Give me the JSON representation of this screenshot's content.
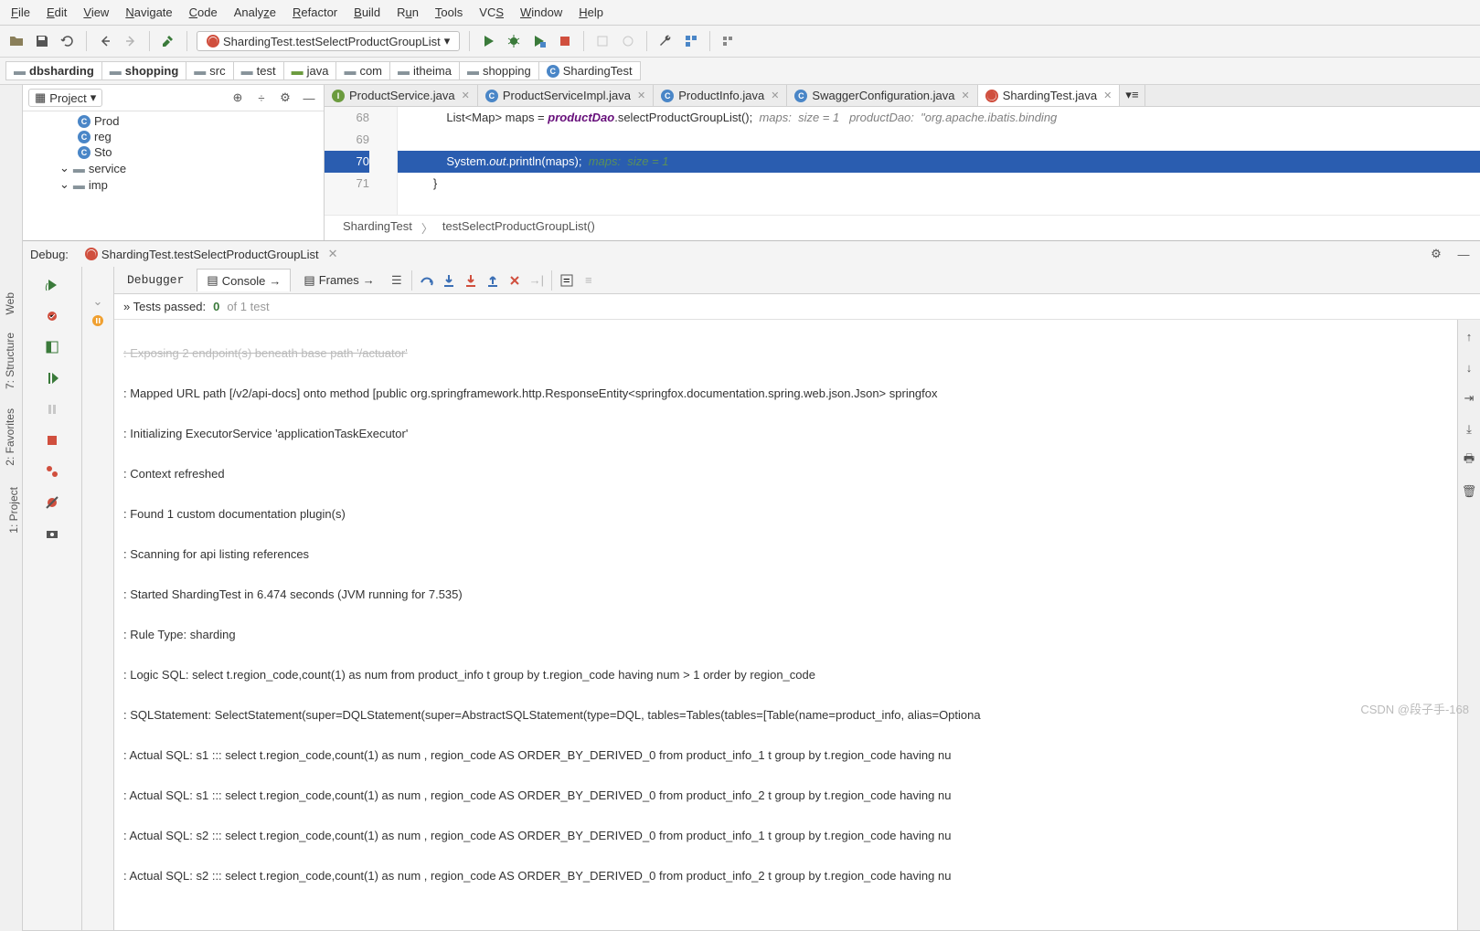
{
  "menu": {
    "file": "File",
    "edit": "Edit",
    "view": "View",
    "navigate": "Navigate",
    "code": "Code",
    "analyze": "Analyze",
    "refactor": "Refactor",
    "build": "Build",
    "run": "Run",
    "tools": "Tools",
    "vcs": "VCS",
    "window": "Window",
    "help": "Help"
  },
  "run_config": "ShardingTest.testSelectProductGroupList",
  "breadcrumb": [
    "dbsharding",
    "shopping",
    "src",
    "test",
    "java",
    "com",
    "itheima",
    "shopping",
    "ShardingTest"
  ],
  "project_label": "Project",
  "tree": {
    "n1": "Prod",
    "n2": "reg",
    "n3": "Sto",
    "n4": "service",
    "n5": "imp"
  },
  "tabs": [
    {
      "icon": "i",
      "label": "ProductService.java",
      "active": false
    },
    {
      "icon": "c",
      "label": "ProductServiceImpl.java",
      "active": false
    },
    {
      "icon": "c",
      "label": "ProductInfo.java",
      "active": false
    },
    {
      "icon": "c",
      "label": "SwaggerConfiguration.java",
      "active": false
    },
    {
      "icon": "t",
      "label": "ShardingTest.java",
      "active": true
    }
  ],
  "gutter": [
    "68",
    "69",
    "70",
    "71"
  ],
  "code": {
    "l68a": "            List<Map> maps = ",
    "l68b": "productDao",
    "l68c": ".selectProductGroupList();  ",
    "l68cmt": "maps:  size = 1   productDao:  \"org.apache.ibatis.binding",
    "l70a": "            System.",
    "l70b": "out",
    "l70c": ".println(maps);  ",
    "l70cmt": "maps:  size = 1",
    "l71": "        }"
  },
  "crumb2": {
    "a": "ShardingTest",
    "b": "testSelectProductGroupList()"
  },
  "debug_label": "Debug:",
  "debug_title": "ShardingTest.testSelectProductGroupList",
  "dbg_tabs": {
    "debugger": "Debugger",
    "console": "Console",
    "frames": "Frames"
  },
  "tests": {
    "prefix": "»  Tests passed: ",
    "count": "0",
    "suffix": " of 1 test"
  },
  "console_lines": [
    ": Exposing 2 endpoint(s) beneath base path '/actuator'",
    ": Mapped URL path [/v2/api-docs] onto method [public org.springframework.http.ResponseEntity<springfox.documentation.spring.web.json.Json> springfox",
    ": Initializing ExecutorService 'applicationTaskExecutor'",
    ": Context refreshed",
    ": Found 1 custom documentation plugin(s)",
    ": Scanning for api listing references",
    ": Started ShardingTest in 6.474 seconds (JVM running for 7.535)",
    ": Rule Type: sharding",
    ": Logic SQL: select t.region_code,count(1) as num from product_info t group by t.region_code having num > 1 order by region_code",
    ": SQLStatement: SelectStatement(super=DQLStatement(super=AbstractSQLStatement(type=DQL, tables=Tables(tables=[Table(name=product_info, alias=Optiona",
    ": Actual SQL: s1 ::: select t.region_code,count(1) as num , region_code AS ORDER_BY_DERIVED_0 from product_info_1 t group by t.region_code having nu",
    ": Actual SQL: s1 ::: select t.region_code,count(1) as num , region_code AS ORDER_BY_DERIVED_0 from product_info_2 t group by t.region_code having nu",
    ": Actual SQL: s2 ::: select t.region_code,count(1) as num , region_code AS ORDER_BY_DERIVED_0 from product_info_1 t group by t.region_code having nu",
    ": Actual SQL: s2 ::: select t.region_code,count(1) as num , region_code AS ORDER_BY_DERIVED_0 from product_info_2 t group by t.region_code having nu"
  ],
  "watermark": "CSDN @段子手-168",
  "sidetabs": {
    "project": "1: Project",
    "web": "Web",
    "structure": "7: Structure",
    "fav": "2: Favorites"
  }
}
